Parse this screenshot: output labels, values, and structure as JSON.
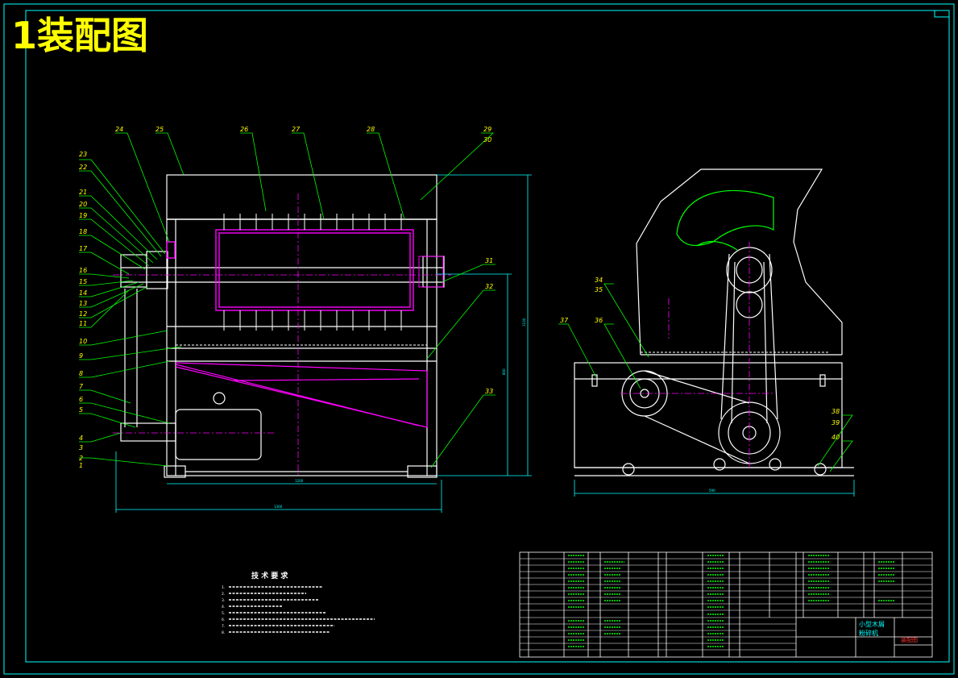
{
  "title": "1装配图",
  "technical_requirements": {
    "heading": "技 术 要 求",
    "items": [
      "1.",
      "2.",
      "3.",
      "4.",
      "5.",
      "6.",
      "7.",
      "8."
    ]
  },
  "balloons_front": [
    "23",
    "22",
    "21",
    "20",
    "19",
    "18",
    "17",
    "16",
    "15",
    "14",
    "13",
    "12",
    "11",
    "10",
    "9",
    "8",
    "7",
    "6",
    "5",
    "4",
    "3",
    "2",
    "1",
    "24",
    "25",
    "26",
    "27",
    "28",
    "29",
    "30",
    "31",
    "32",
    "33"
  ],
  "balloons_side": [
    "34",
    "35",
    "36",
    "37",
    "38",
    "39",
    "40"
  ],
  "dimensions": {
    "front_width": "1200",
    "front_overall_width": "1300",
    "front_height_inner": "800",
    "front_height_outer": "1100",
    "side_width": "590"
  },
  "title_block": {
    "name_line1": "小型木屑",
    "name_line2": "粉碎机",
    "stamp": "装配图"
  },
  "colors": {
    "background": "#000000",
    "outline": "#ffffff",
    "leaders": "#00ff00",
    "center_lines": "#ff00ff",
    "hatching": "#ff00ff",
    "dimensions": "#00ffff",
    "balloon_text": "#ffff00",
    "title": "#ffff00",
    "stamp": "#ff3333"
  }
}
